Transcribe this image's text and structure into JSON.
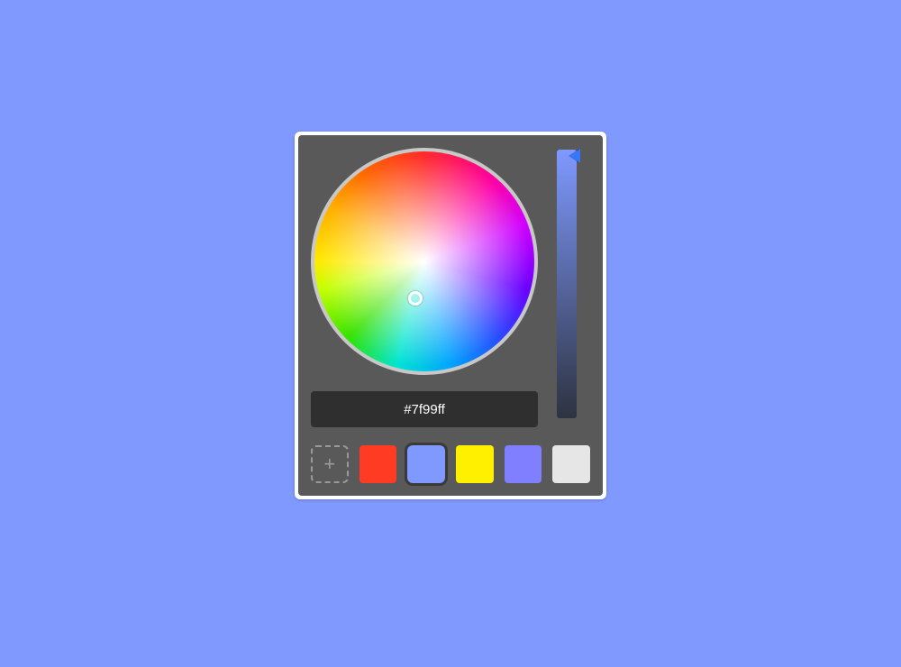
{
  "picker": {
    "hex_value": "#7f99ff",
    "brightness_gradient_top": "#7f99ff",
    "brightness_gradient_bottom": "#2d3340",
    "selected_color": "#7f99ff",
    "add_label": "+"
  },
  "swatches": [
    {
      "color": "#ff3b24",
      "selected": false
    },
    {
      "color": "#7f99ff",
      "selected": true
    },
    {
      "color": "#fff000",
      "selected": false
    },
    {
      "color": "#7f7fff",
      "selected": false
    },
    {
      "color": "#e6e6e6",
      "selected": false
    }
  ],
  "colors": {
    "page_bg": "#7f99ff",
    "panel_bg": "#595959",
    "outer_bg": "#ffffff",
    "input_bg": "#2f2f2f",
    "input_text": "#ffffff",
    "dashed_border": "#9a9a9a"
  }
}
